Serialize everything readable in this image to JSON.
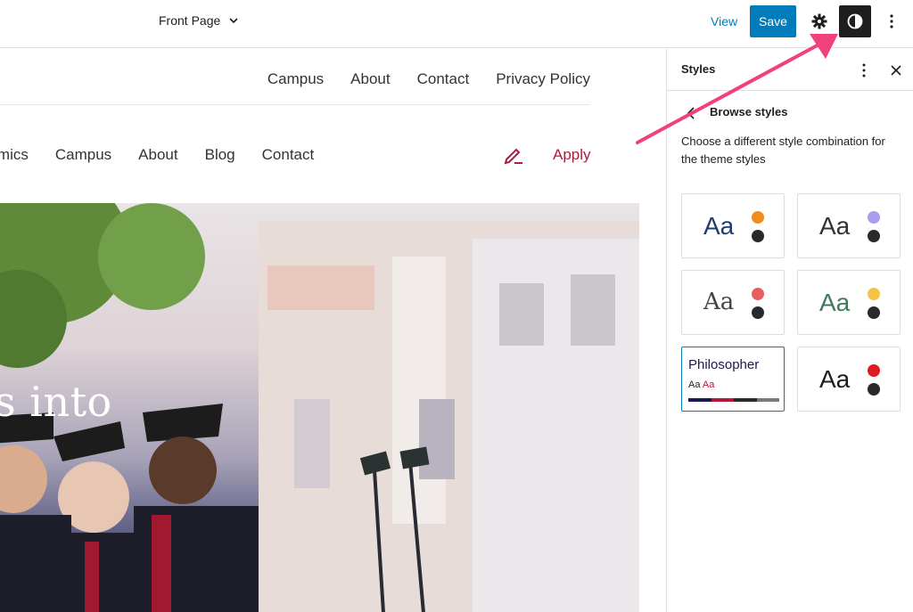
{
  "toolbar": {
    "document_title": "Front Page",
    "view_label": "View",
    "save_label": "Save",
    "icons": [
      "chevron-down-icon",
      "gear-icon",
      "half-circle-contrast-icon",
      "vertical-ellipsis-icon"
    ]
  },
  "site": {
    "secondary_nav": [
      "Campus",
      "About",
      "Contact",
      "Privacy Policy"
    ],
    "main_nav": [
      "demics",
      "Campus",
      "About",
      "Blog",
      "Contact"
    ],
    "apply_label": "Apply",
    "hero_text": "s into"
  },
  "sidebar": {
    "title": "Styles",
    "subtitle": "Browse styles",
    "description": "Choose a different style combination for the theme styles",
    "variations": [
      {
        "aa": "Aa",
        "aa_color": "#1e3d6e",
        "accent": "#f08c1e",
        "font": "sans"
      },
      {
        "aa": "Aa",
        "aa_color": "#333333",
        "accent": "#a99cf2",
        "font": "sans"
      },
      {
        "aa": "Aa",
        "aa_color": "#444444",
        "accent": "#e85d5d",
        "font": "serif"
      },
      {
        "aa": "Aa",
        "aa_color": "#3f7a5c",
        "accent": "#f3c544",
        "font": "sans"
      },
      {
        "name": "Philosopher",
        "aa": "Aa",
        "aa_accent": "Aa",
        "selected": true
      },
      {
        "aa": "Aa",
        "aa_color": "#1e1e1e",
        "accent": "#e01b24",
        "font": "sans"
      }
    ]
  },
  "colors": {
    "accent_blue": "#007cba",
    "apply_red": "#b11a3d",
    "callout_pink": "#f0417a",
    "philosopher_palette": [
      "#1a1a4e",
      "#b11a3d",
      "#2a2a2a",
      "#7a7a7a"
    ]
  }
}
